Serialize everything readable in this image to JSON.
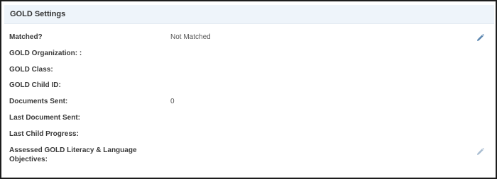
{
  "panel": {
    "title": "GOLD Settings"
  },
  "fields": [
    {
      "label": "Matched?",
      "value": "Not Matched",
      "editable": true
    },
    {
      "label": "GOLD Organization: :",
      "value": ""
    },
    {
      "label": "GOLD Class:",
      "value": ""
    },
    {
      "label": "GOLD Child ID:",
      "value": ""
    },
    {
      "label": "Documents Sent:",
      "value": "0"
    },
    {
      "label": "Last Document Sent:",
      "value": ""
    },
    {
      "label": "Last Child Progress:",
      "value": ""
    },
    {
      "label": "Assessed GOLD Literacy & Language Objectives:",
      "value": "",
      "editable": true
    }
  ],
  "icons": {
    "edit_primary": "pencil-icon",
    "edit_secondary": "pencil-icon"
  },
  "colors": {
    "header_background": "#eef4fa",
    "label_text": "#3a3a3a",
    "value_text": "#555555",
    "edit_icon_active": "#5b86b0",
    "edit_icon_muted": "#a9bdd1",
    "frame_border": "#1c1c1c"
  }
}
